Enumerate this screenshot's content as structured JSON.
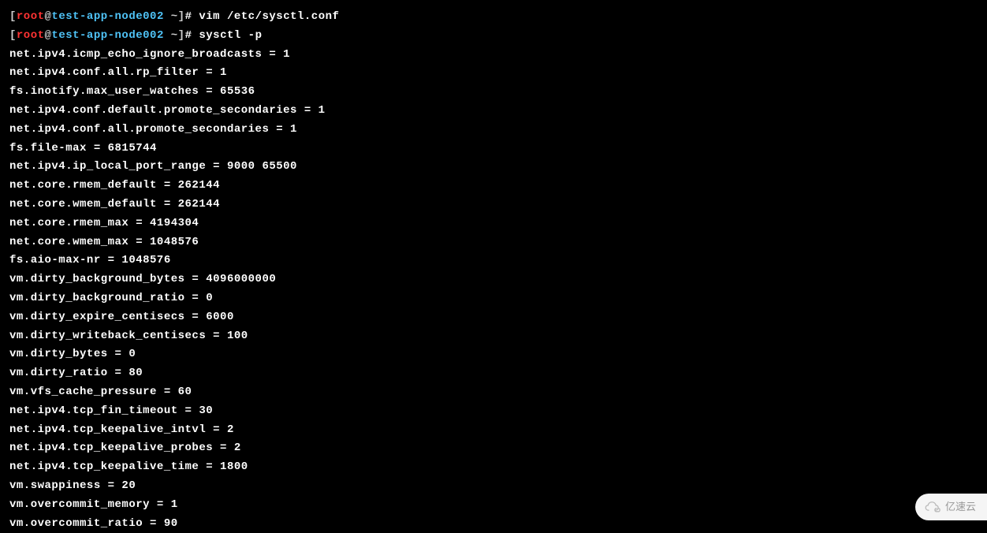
{
  "prompt": {
    "bracket_open": "[",
    "user": "root",
    "at": "@",
    "hostname": "test-app-node002",
    "space_tilde": " ~",
    "bracket_close": "]",
    "hash": "# "
  },
  "commands": [
    "vim /etc/sysctl.conf",
    "sysctl -p"
  ],
  "output": [
    "net.ipv4.icmp_echo_ignore_broadcasts = 1",
    "net.ipv4.conf.all.rp_filter = 1",
    "fs.inotify.max_user_watches = 65536",
    "net.ipv4.conf.default.promote_secondaries = 1",
    "net.ipv4.conf.all.promote_secondaries = 1",
    "fs.file-max = 6815744",
    "net.ipv4.ip_local_port_range = 9000 65500",
    "net.core.rmem_default = 262144",
    "net.core.wmem_default = 262144",
    "net.core.rmem_max = 4194304",
    "net.core.wmem_max = 1048576",
    "fs.aio-max-nr = 1048576",
    "vm.dirty_background_bytes = 4096000000",
    "vm.dirty_background_ratio = 0",
    "vm.dirty_expire_centisecs = 6000",
    "vm.dirty_writeback_centisecs = 100",
    "vm.dirty_bytes = 0",
    "vm.dirty_ratio = 80",
    "vm.vfs_cache_pressure = 60",
    "net.ipv4.tcp_fin_timeout = 30",
    "net.ipv4.tcp_keepalive_intvl = 2",
    "net.ipv4.tcp_keepalive_probes = 2",
    "net.ipv4.tcp_keepalive_time = 1800",
    "vm.swappiness = 20",
    "vm.overcommit_memory = 1",
    "vm.overcommit_ratio = 90"
  ],
  "watermark": {
    "text": "亿速云"
  }
}
